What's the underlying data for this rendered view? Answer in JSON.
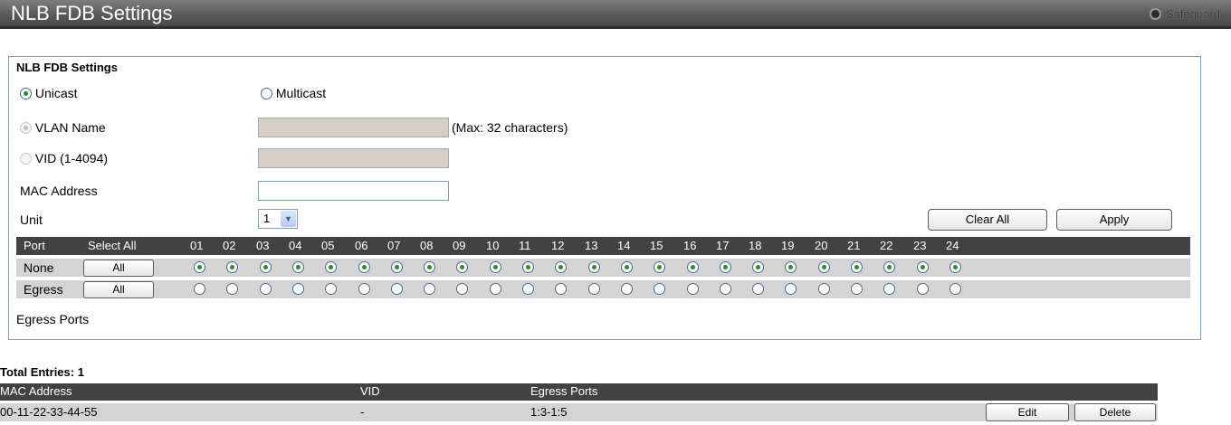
{
  "header": {
    "title": "NLB FDB Settings",
    "safeguard_label": "Safeguard"
  },
  "form": {
    "section_title": "NLB FDB Settings",
    "type_options": {
      "unicast": "Unicast",
      "multicast": "Multicast",
      "selected": "Unicast"
    },
    "vlan_name_label": "VLAN Name",
    "vlan_name_value": "",
    "vlan_name_hint": "(Max: 32 characters)",
    "vid_label": "VID (1-4094)",
    "vid_value": "",
    "mac_label": "MAC Address",
    "mac_value": "",
    "unit_label": "Unit",
    "unit_value": "1",
    "clear_all_label": "Clear All",
    "apply_label": "Apply",
    "egress_ports_label": "Egress Ports"
  },
  "port_table": {
    "port_header": "Port",
    "select_all_header": "Select All",
    "ports": [
      "01",
      "02",
      "03",
      "04",
      "05",
      "06",
      "07",
      "08",
      "09",
      "10",
      "11",
      "12",
      "13",
      "14",
      "15",
      "16",
      "17",
      "18",
      "19",
      "20",
      "21",
      "22",
      "23",
      "24"
    ],
    "rows": [
      {
        "label": "None",
        "button": "All",
        "selected": true
      },
      {
        "label": "Egress",
        "button": "All",
        "selected": false
      }
    ]
  },
  "entries": {
    "total_label": "Total Entries: 1",
    "columns": [
      "MAC Address",
      "VID",
      "Egress Ports"
    ],
    "rows": [
      {
        "mac": "00-11-22-33-44-55",
        "vid": "-",
        "egress": "1:3-1:5"
      }
    ],
    "edit_label": "Edit",
    "delete_label": "Delete"
  }
}
